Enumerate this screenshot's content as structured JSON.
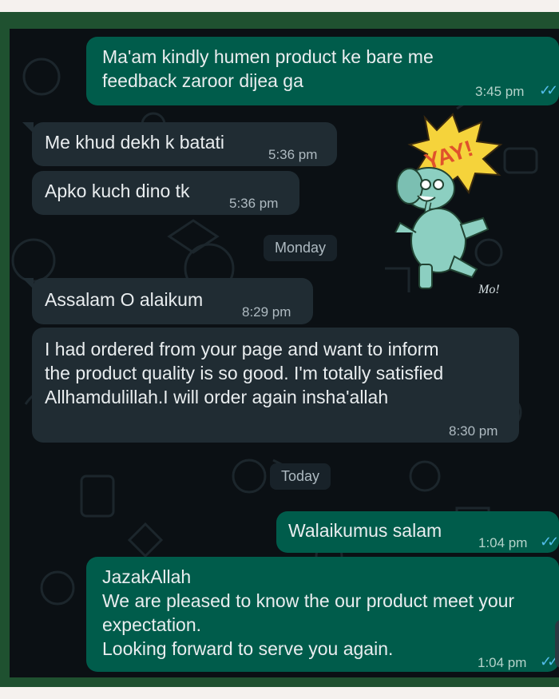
{
  "messages": [
    {
      "id": "m1",
      "dir": "out",
      "text": "Ma'am kindly humen product ke bare me\nfeedback zaroor dijea ga",
      "time": "3:45 pm",
      "read": true
    },
    {
      "id": "m2",
      "dir": "in",
      "text": "Me khud dekh k batati",
      "time": "5:36 pm"
    },
    {
      "id": "m3",
      "dir": "in",
      "text": "Apko kuch dino tk",
      "time": "5:36 pm"
    },
    {
      "id": "m4",
      "dir": "in",
      "text": "Assalam O alaikum",
      "time": "8:29 pm"
    },
    {
      "id": "m5",
      "dir": "in",
      "text": "I had ordered from your page and want to inform\nthe product quality is so good. I'm totally satisfied\nAllhamdulillah.I will order again insha'allah",
      "time": "8:30 pm"
    },
    {
      "id": "m6",
      "dir": "out",
      "text": "Walaikumus salam",
      "time": "1:04 pm",
      "read": true
    },
    {
      "id": "m7",
      "dir": "out",
      "text": "JazakAllah\nWe are pleased to know the our product meet your\nexpectation.\nLooking forward to serve you again.",
      "time": "1:04 pm",
      "read": true
    }
  ],
  "dividers": {
    "monday": "Monday",
    "today": "Today"
  },
  "sticker": {
    "banner": "YAY!",
    "signature": "Mo!"
  },
  "colors": {
    "outgoing": "#005c4b",
    "incoming": "#202c33",
    "background": "#0b1014",
    "frame": "#1f5130",
    "tick": "#53bdeb"
  }
}
